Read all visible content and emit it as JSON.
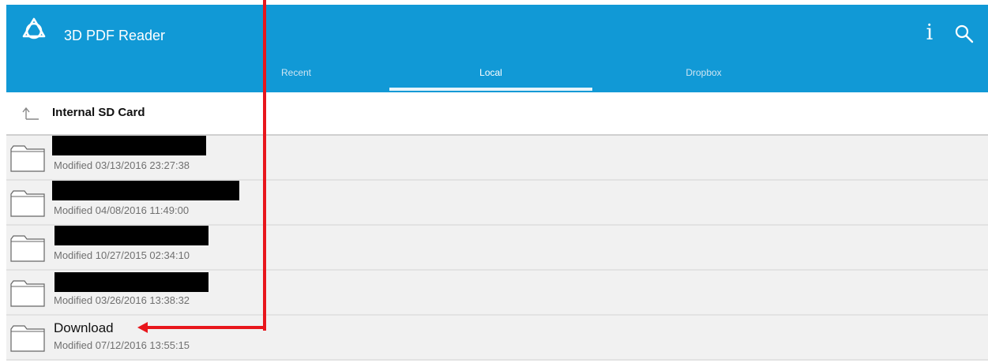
{
  "app": {
    "title": "3D PDF Reader"
  },
  "tabs": [
    {
      "label": "Recent",
      "active": false
    },
    {
      "label": "Local",
      "active": true
    },
    {
      "label": "Dropbox",
      "active": false
    }
  ],
  "path": {
    "label": "Internal SD Card"
  },
  "files": [
    {
      "name": "",
      "redacted": true,
      "modified": "Modified 03/13/2016 23:27:38"
    },
    {
      "name": "",
      "redacted": true,
      "modified": "Modified 04/08/2016 11:49:00"
    },
    {
      "name": "",
      "redacted": true,
      "modified": "Modified 10/27/2015 02:34:10"
    },
    {
      "name": "",
      "redacted": true,
      "modified": "Modified 03/26/2016 13:38:32"
    },
    {
      "name": "Download",
      "redacted": false,
      "modified": "Modified 07/12/2016 13:55:15"
    }
  ],
  "colors": {
    "appbar": "#1199d6",
    "annotation": "#e8161c"
  },
  "icons": [
    "app-logo-icon",
    "info-icon",
    "search-icon",
    "up-arrow-icon",
    "folder-icon"
  ]
}
